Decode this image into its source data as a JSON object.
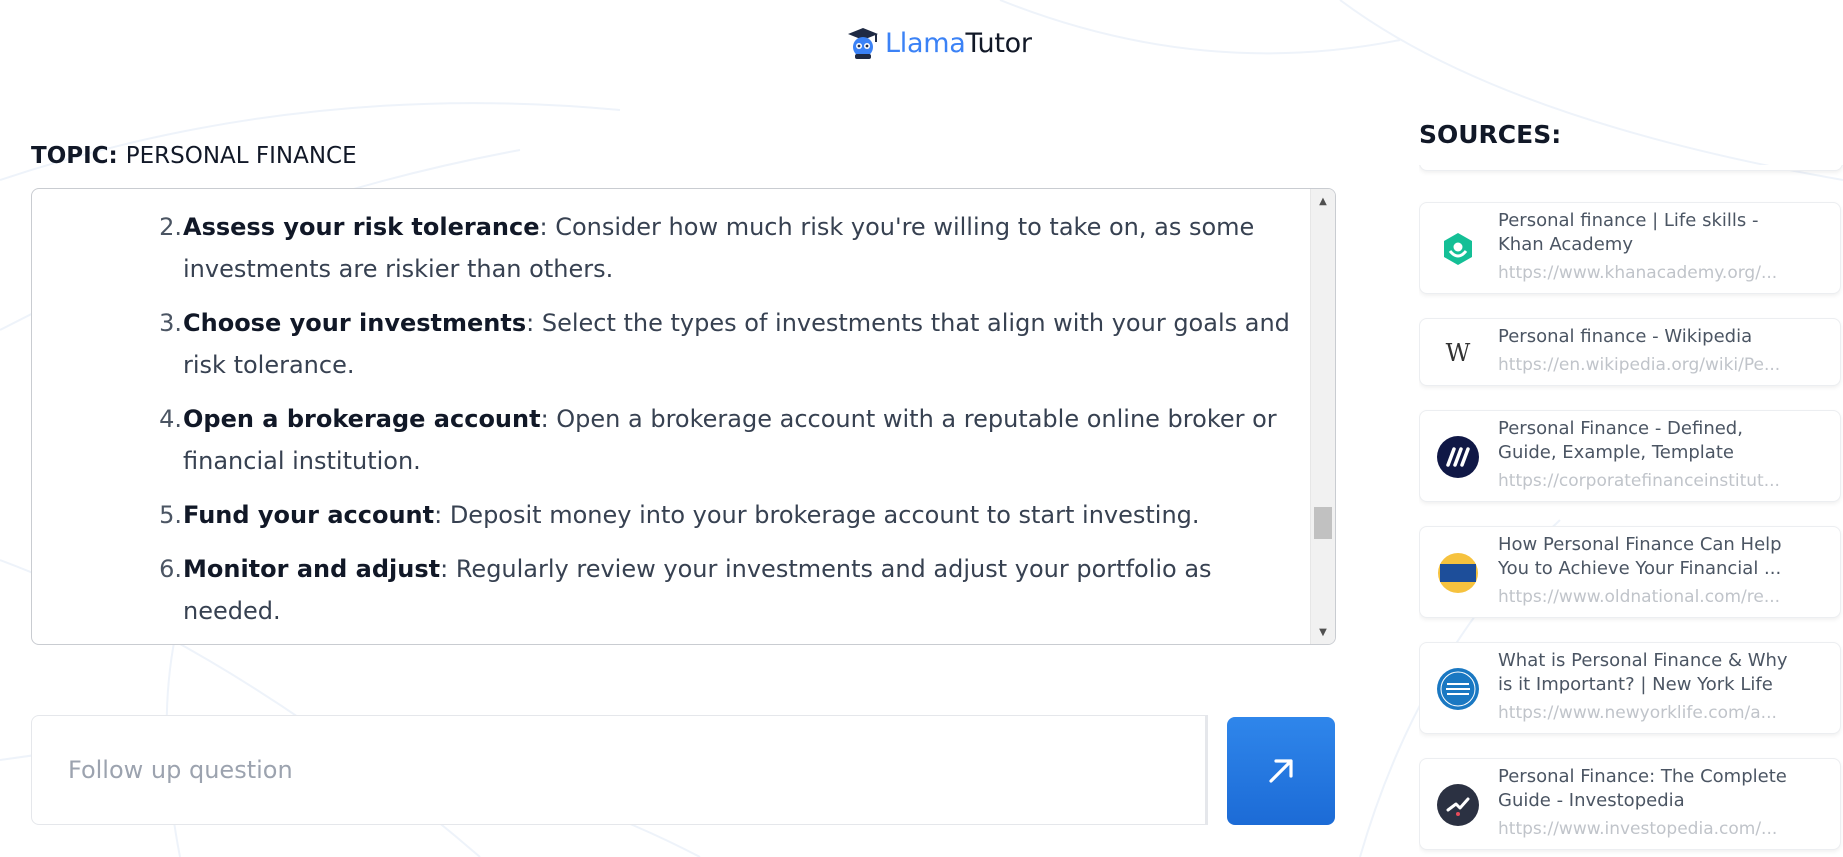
{
  "header": {
    "logo_part1": "Llama",
    "logo_part2": "Tutor",
    "logo_icon": "llama-graduate-icon"
  },
  "topic": {
    "label": "TOPIC:",
    "value": "PERSONAL FINANCE"
  },
  "answer": {
    "items": [
      {
        "number": "2.",
        "term": "Assess your risk tolerance",
        "text": ": Consider how much risk you're willing to take on, as some investments are riskier than others."
      },
      {
        "number": "3.",
        "term": "Choose your investments",
        "text": ": Select the types of investments that align with your goals and risk tolerance."
      },
      {
        "number": "4.",
        "term": "Open a brokerage account",
        "text": ": Open a brokerage account with a reputable online broker or financial institution."
      },
      {
        "number": "5.",
        "term": "Fund your account",
        "text": ": Deposit money into your brokerage account to start investing."
      },
      {
        "number": "6.",
        "term": "Monitor and adjust",
        "text": ": Regularly review your investments and adjust your portfolio as needed."
      }
    ]
  },
  "followup": {
    "placeholder": "Follow up question",
    "value": "",
    "send_icon": "arrow-up-right-icon"
  },
  "sources": {
    "title": "SOURCES:",
    "items": [
      {
        "title": "Personal finance | Life skills - Khan Academy",
        "url": "https://www.khanacademy.org/...",
        "icon": "khan-academy-icon"
      },
      {
        "title": "Personal finance - Wikipedia",
        "url": "https://en.wikipedia.org/wiki/Pe...",
        "icon": "wikipedia-icon"
      },
      {
        "title": "Personal Finance - Defined, Guide, Example, Template",
        "url": "https://corporatefinanceinstitut...",
        "icon": "cfi-icon"
      },
      {
        "title": "How Personal Finance Can Help You to Achieve Your Financial ...",
        "url": "https://www.oldnational.com/re...",
        "icon": "old-national-icon"
      },
      {
        "title": "What is Personal Finance & Why is it Important? | New York Life",
        "url": "https://www.newyorklife.com/a...",
        "icon": "new-york-life-icon"
      },
      {
        "title": "Personal Finance: The Complete Guide - Investopedia",
        "url": "https://www.investopedia.com/...",
        "icon": "investopedia-icon"
      }
    ]
  },
  "colors": {
    "accent": "#2f86eb",
    "logo_blue": "#3b82f6",
    "send_button": "#1c6bd6"
  }
}
